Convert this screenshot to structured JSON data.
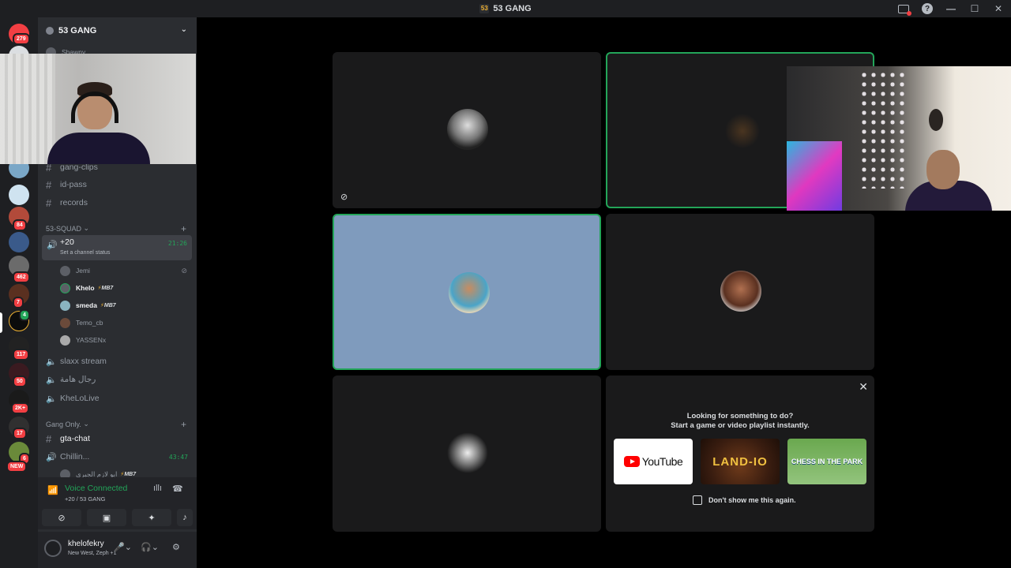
{
  "window": {
    "title": "53 GANG",
    "logo": "53"
  },
  "guild_badges": [
    "279",
    "84",
    "462",
    "7",
    "117",
    "50",
    "2K+",
    "17",
    "6",
    "NEW",
    "4"
  ],
  "server": {
    "name": "53 GANG"
  },
  "channels_top": [
    {
      "name": "Shawny"
    },
    {
      "name": "gang-clips"
    },
    {
      "name": "id-pass"
    },
    {
      "name": "records"
    }
  ],
  "category_squad": "53-SQUAD",
  "active_voice": {
    "name": "+20",
    "status": "Set a channel status",
    "time": "21:26"
  },
  "voice_users": [
    {
      "name": "Jemi",
      "tag": ""
    },
    {
      "name": "Khelo",
      "tag": "MB7"
    },
    {
      "name": "smeda",
      "tag": "MB7"
    },
    {
      "name": "Temo_cb",
      "tag": ""
    },
    {
      "name": "YASSENx",
      "tag": ""
    }
  ],
  "voice_channels": [
    {
      "name": "slaxx stream"
    },
    {
      "name": "رجال هامة"
    },
    {
      "name": "KheLoLive"
    }
  ],
  "category_gang": "Gang Only.",
  "gang_channels": [
    {
      "name": "gta-chat"
    },
    {
      "name": "Chillin...",
      "time": "43:47"
    },
    {
      "name": "ابو لازم الجبري",
      "tag": "MB7"
    }
  ],
  "voice_panel": {
    "title": "Voice Connected",
    "subtitle": "+20 / 53 GANG"
  },
  "user": {
    "name": "khelofekry",
    "status": "New West, Zeph +1"
  },
  "activity_prompt": {
    "line1": "Looking for something to do?",
    "line2": "Start a game or video playlist instantly.",
    "cards": [
      "YouTube",
      "LAND-IO",
      "CHESS IN THE PARK"
    ],
    "checkbox_label": "Don't show me this again."
  },
  "colors": {
    "green": "#23a559",
    "red": "#f23f43",
    "bg": "#000000",
    "sidebar": "#2b2d31",
    "speaking_tile": "#7f9bbd"
  }
}
